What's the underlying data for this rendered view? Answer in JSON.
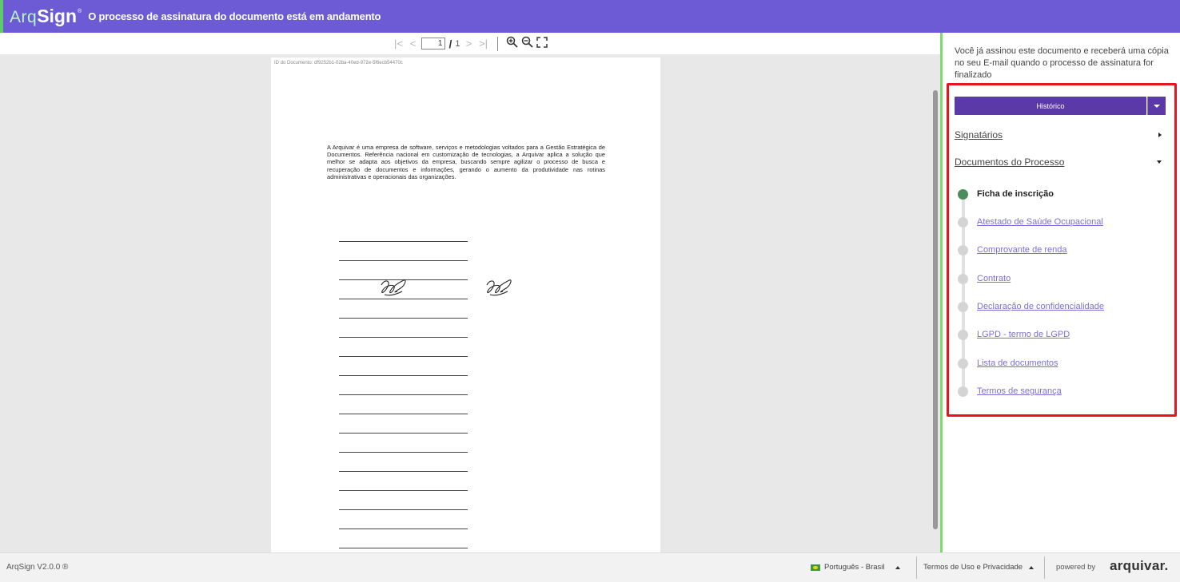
{
  "header": {
    "logo_arq": "Arq",
    "logo_sign": "Sign",
    "logo_reg": "®",
    "title": "O processo de assinatura do documento está em andamento"
  },
  "toolbar": {
    "first_icon": "first-page-icon",
    "prev_icon": "prev-page-icon",
    "page_value": "1",
    "separator": "/",
    "total_pages": "1",
    "next_icon": "next-page-icon",
    "last_icon": "last-page-icon",
    "zoom_in_icon": "zoom-in-icon",
    "zoom_out_icon": "zoom-out-icon",
    "fullscreen_icon": "fullscreen-icon"
  },
  "document": {
    "id_text": "ID do Documento: df9252b1-02ba-40ed-972e-5f6ecb54470c",
    "body": "A Arquivar é uma empresa de software, serviços e metodologias voltados para a Gestão Estratégica de Documentos. Referência nacional em customização de tecnologias, a Arquivar aplica a solução que melhor se adapta aos objetivos da empresa, buscando sempre agilizar o processo de busca e recuperação de documentos e informações, gerando o aumento da produtividade nas rotinas administrativas e operacionais das organizações."
  },
  "panel": {
    "message": "Você já assinou este documento e receberá uma cópia no seu E-mail quando o processo de assinatura for finalizado",
    "history_button": "Histórico",
    "signatories": "Signatários",
    "process_documents": "Documentos do Processo",
    "documents": [
      {
        "label": "Ficha de inscrição",
        "active": true
      },
      {
        "label": "Atestado de Saúde Ocupacional",
        "active": false
      },
      {
        "label": "Comprovante de renda",
        "active": false
      },
      {
        "label": "Contrato",
        "active": false
      },
      {
        "label": "Declaração de confidencialidade",
        "active": false
      },
      {
        "label": "LGPD - termo de LGPD",
        "active": false
      },
      {
        "label": "Lista de documentos",
        "active": false
      },
      {
        "label": "Termos de segurança",
        "active": false
      }
    ]
  },
  "footer": {
    "version": "ArqSign V2.0.0 ®",
    "language": "Português - Brasil",
    "terms": "Termos de Uso e Privacidade",
    "powered_by": "powered by",
    "brand": "arquivar."
  },
  "colors": {
    "header_bg": "#6c5bd4",
    "accent_green": "#7ddb6f",
    "button_purple": "#5b3aa8",
    "link_purple": "#7b6fd6",
    "highlight_red": "#e8141a",
    "active_dot": "#4a8c5c"
  }
}
